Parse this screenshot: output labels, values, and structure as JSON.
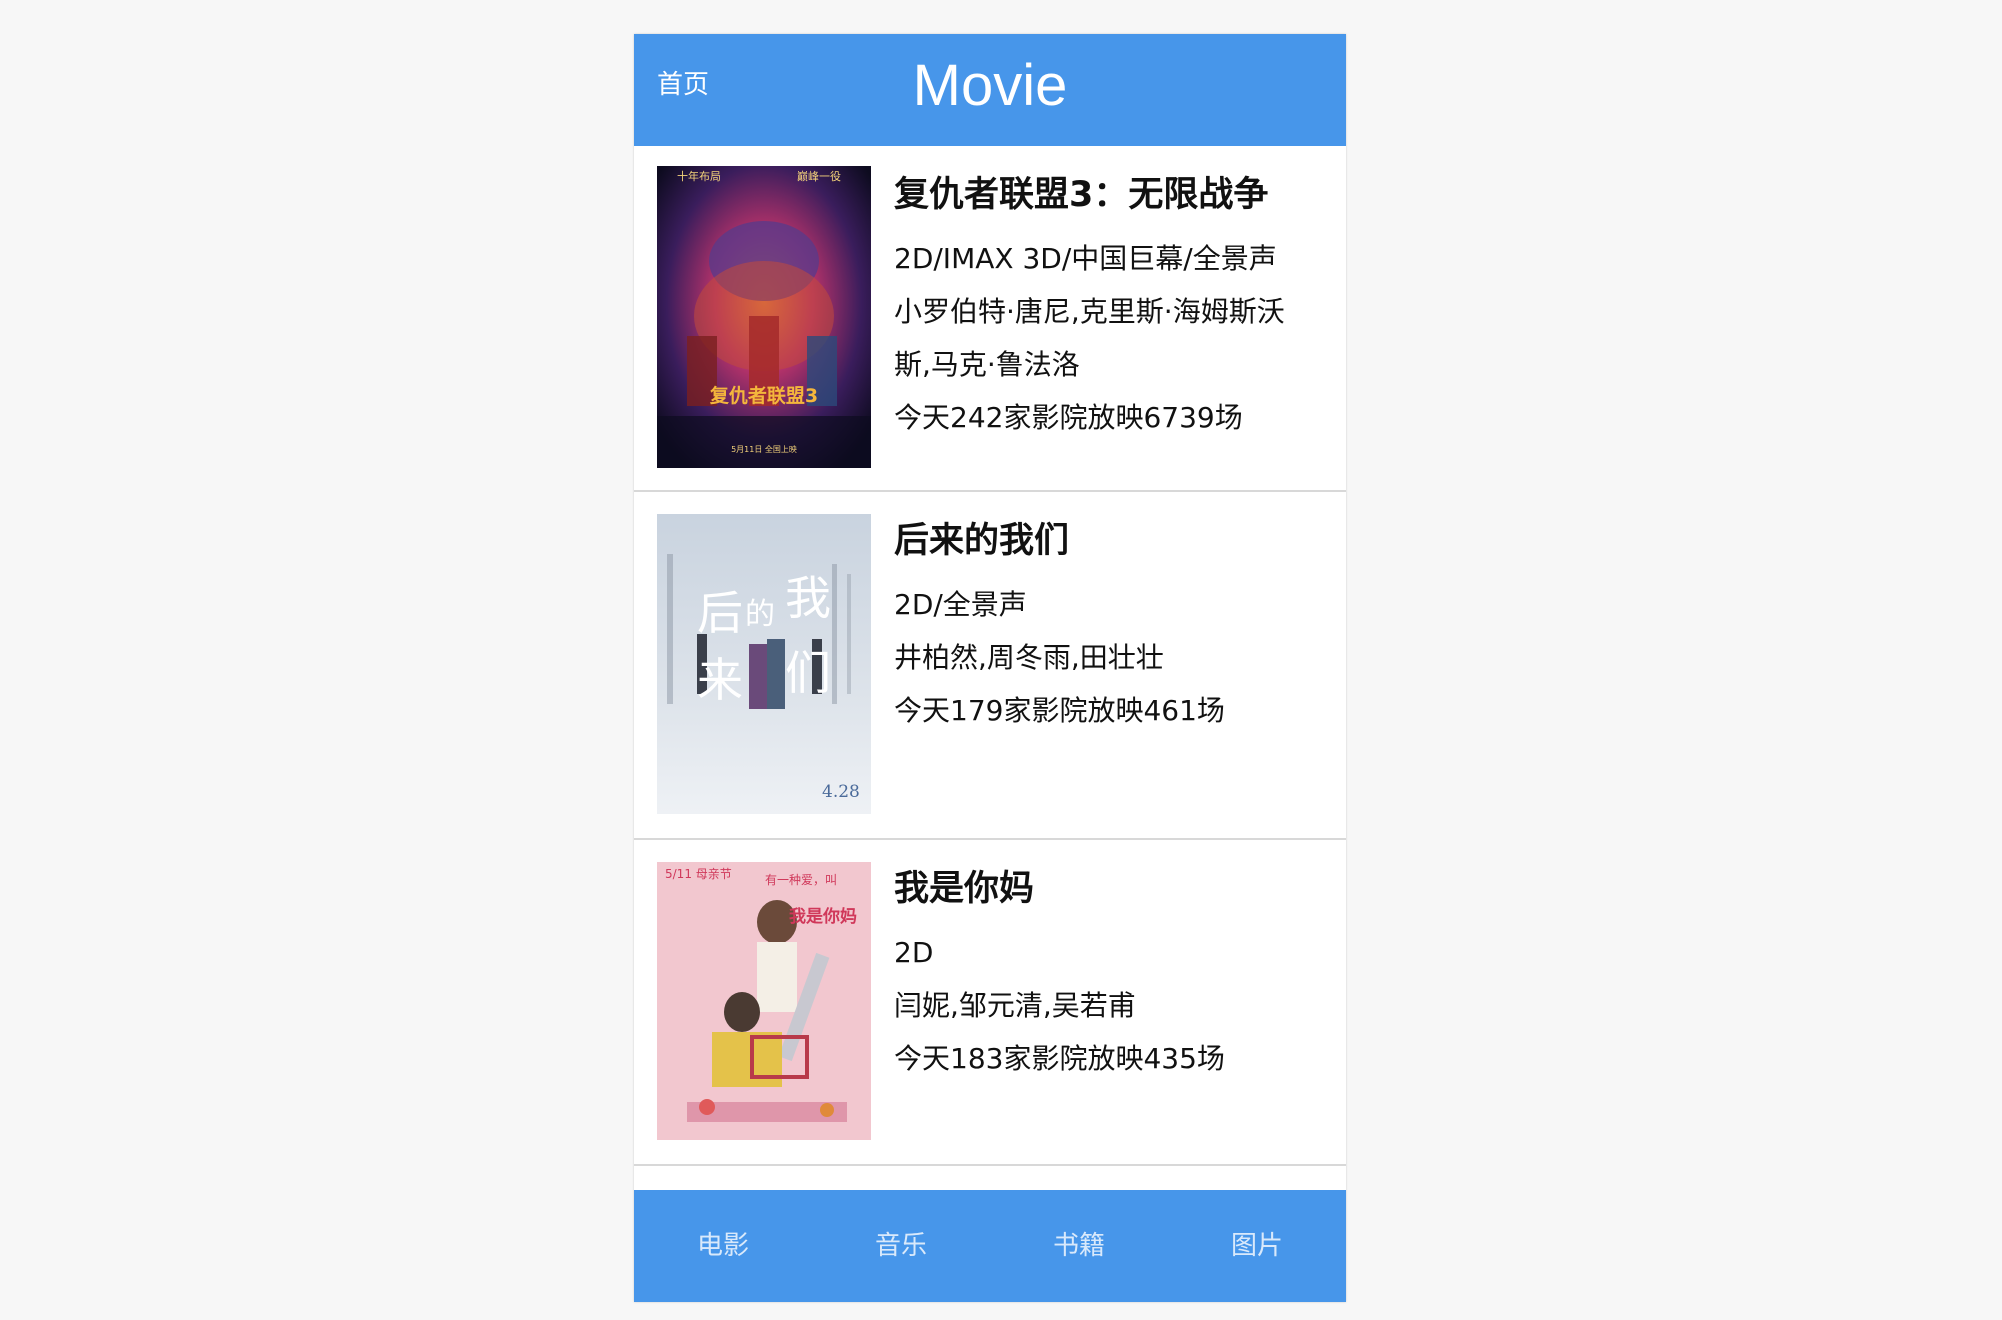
{
  "header": {
    "home_label": "首页",
    "title": "Movie"
  },
  "movies": [
    {
      "title": "复仇者联盟3：无限战争",
      "formats": "2D/IMAX 3D/中国巨幕/全景声",
      "cast_line1": "小罗伯特·唐尼,克里斯·海姆斯沃",
      "cast_line2": "斯,马克·鲁法洛",
      "showtimes": "今天242家影院放映6739场",
      "poster": {
        "top_left": "十年布局",
        "top_right": "巅峰一役",
        "logo": "复仇者联盟3",
        "date": "5月11日 全国上映"
      }
    },
    {
      "title": "后来的我们",
      "formats": "2D/全景声",
      "cast": "井柏然,周冬雨,田壮壮",
      "showtimes": "今天179家影院放映461场",
      "poster": {
        "big_text_a": "后",
        "big_text_b": "来",
        "big_text_c": "的",
        "big_text_d": "我",
        "big_text_e": "们",
        "date": "4.28"
      }
    },
    {
      "title": "我是你妈",
      "formats": "2D",
      "cast": "闫妮,邹元清,吴若甫",
      "showtimes": "今天183家影院放映435场",
      "poster": {
        "date_text": "5/11 母亲节",
        "tag": "有一种爱，叫",
        "big_text": "我是你妈"
      }
    }
  ],
  "tabbar": {
    "tabs": [
      "电影",
      "音乐",
      "书籍",
      "图片"
    ]
  },
  "colors": {
    "primary": "#4796ea",
    "tab_text": "#d9e9fb",
    "page_bg": "#f7f7f7"
  }
}
